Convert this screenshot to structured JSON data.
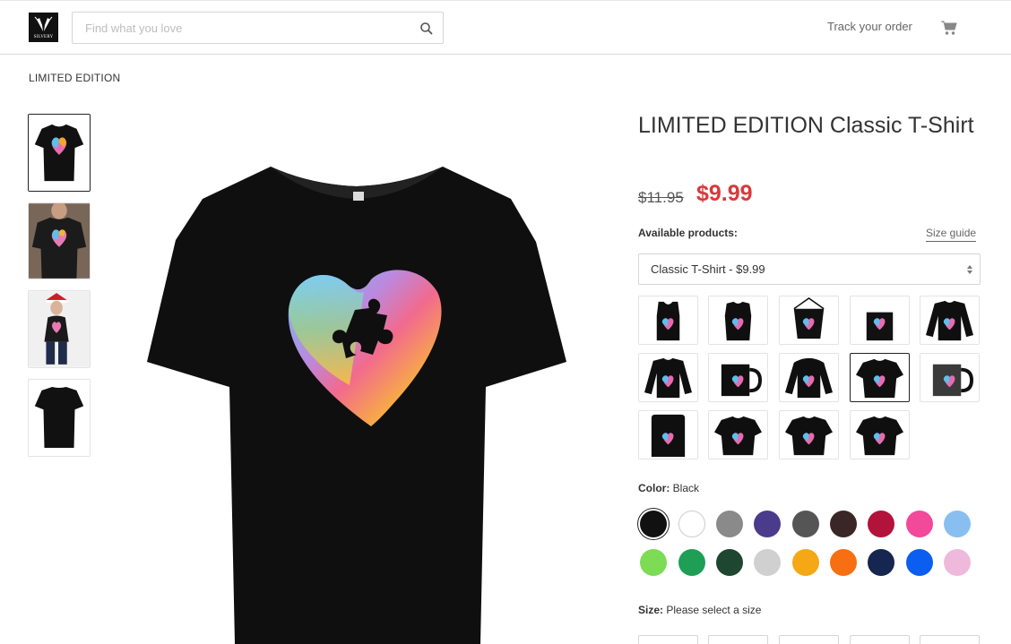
{
  "header": {
    "logo_text": "SILVERY",
    "search_placeholder": "Find what you love",
    "track_label": "Track your order"
  },
  "breadcrumb": "LIMITED EDITION",
  "product": {
    "title": "LIMITED EDITION Classic T-Shirt",
    "old_price": "$11.95",
    "new_price": "$9.99",
    "available_label": "Available products:",
    "size_guide": "Size guide",
    "selected_product": "Classic T-Shirt - $9.99",
    "product_types": [
      "Tank Top",
      "Sleeveless",
      "Drawstring Bag",
      "Tote Bag",
      "Long Sleeve",
      "Hoodie",
      "Black Mug",
      "Pullover Hoodie",
      "Classic T-Shirt",
      "Color Changing Mug",
      "Phone Case",
      "Premium T-Shirt",
      "Ladies T-Shirt",
      "V-Neck"
    ],
    "color_label": "Color:",
    "color_value": "Black",
    "colors": [
      "#111111",
      "#ffffff",
      "#8a8a8a",
      "#4a3b8c",
      "#555555",
      "#3a2626",
      "#b3123a",
      "#f2499a",
      "#89bff0",
      "#7ddb55",
      "#1f9e55",
      "#1e4630",
      "#d0d0d0",
      "#f5a716",
      "#f76f12",
      "#152650",
      "#0c5ef0",
      "#efb9dc"
    ],
    "size_label": "Size:",
    "size_value": "Please select a size"
  }
}
